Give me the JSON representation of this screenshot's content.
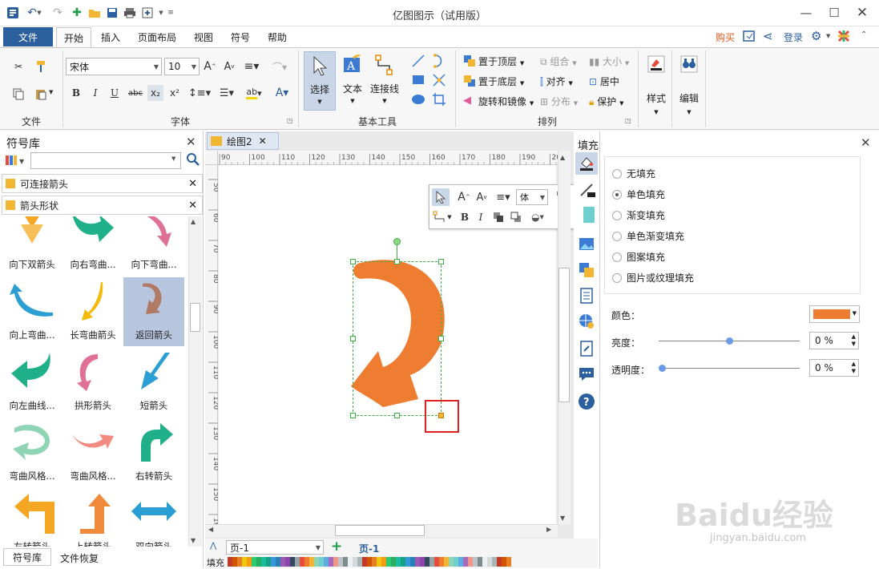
{
  "app": {
    "title": "亿图图示（试用版）"
  },
  "tabs": [
    "文件",
    "开始",
    "插入",
    "页面布局",
    "视图",
    "符号",
    "帮助"
  ],
  "topright": {
    "buy": "购买",
    "login": "登录"
  },
  "ribbon": {
    "groups": [
      "文件",
      "字体",
      "基本工具",
      "排列",
      "样式",
      "编辑"
    ],
    "font_name": "宋体",
    "font_size": "10",
    "tools": {
      "select": "选择",
      "text": "文本",
      "connector": "连接线"
    },
    "arrange": {
      "bring_front": "置于顶层",
      "send_back": "置于底层",
      "rotate_mirror": "旋转和镜像",
      "group": "组合",
      "align": "对齐",
      "distribute": "分布",
      "size": "大小",
      "center": "居中",
      "protect": "保护"
    },
    "style_label": "样式",
    "edit_label": "编辑"
  },
  "library": {
    "title": "符号库",
    "search_placeholder": "",
    "categories": [
      "可连接箭头",
      "箭头形状"
    ],
    "shapes": [
      {
        "label": "向下双箭头",
        "color": "#f5a623"
      },
      {
        "label": "向右弯曲...",
        "color": "#1fb08a"
      },
      {
        "label": "向下弯曲...",
        "color": "#e07096"
      },
      {
        "label": "向上弯曲...",
        "color": "#2b9fd4"
      },
      {
        "label": "长弯曲箭头",
        "color": "#f5b90a"
      },
      {
        "label": "返回箭头",
        "color": "#b07a64"
      },
      {
        "label": "向左曲线...",
        "color": "#1fb08a"
      },
      {
        "label": "拱形箭头",
        "color": "#e07096"
      },
      {
        "label": "短箭头",
        "color": "#2b9fd4"
      },
      {
        "label": "弯曲风格...",
        "color": "#8fd4b4"
      },
      {
        "label": "弯曲风格...",
        "color": "#f28b82"
      },
      {
        "label": "右转箭头",
        "color": "#1fb08a"
      },
      {
        "label": "左转箭头",
        "color": "#f5a623"
      },
      {
        "label": "上转箭头",
        "color": "#f08a3a"
      },
      {
        "label": "双向箭头",
        "color": "#2b9fd4"
      }
    ],
    "bottom_tabs": [
      "符号库",
      "文件恢复"
    ]
  },
  "document": {
    "tab_name": "绘图2",
    "ruler_top": [
      "90",
      "100",
      "110",
      "120",
      "130",
      "140",
      "150",
      "160",
      "170",
      "180",
      "190",
      "200"
    ],
    "ruler_left": [
      "50",
      "60",
      "70",
      "80",
      "90",
      "100",
      "110",
      "120",
      "130",
      "140",
      "150",
      "160"
    ],
    "shape_color": "#ef7d31",
    "mini_font": "体"
  },
  "pages": {
    "current": "页-1",
    "tab": "页-1",
    "fill_label": "填充"
  },
  "fill_panel": {
    "title": "填充",
    "options": [
      "无填充",
      "单色填充",
      "渐变填充",
      "单色渐变填充",
      "图案填充",
      "图片或纹理填充"
    ],
    "selected": "单色填充",
    "color_label": "颜色：",
    "color_value": "#ef7d31",
    "brightness_label": "亮度：",
    "brightness_value": "0 %",
    "brightness_level": 0.5,
    "transparency_label": "透明度：",
    "transparency_value": "0 %",
    "transparency_level": 0.0
  },
  "watermark": {
    "line1": "Baidu经验",
    "line2": "jingyan.baidu.com"
  }
}
